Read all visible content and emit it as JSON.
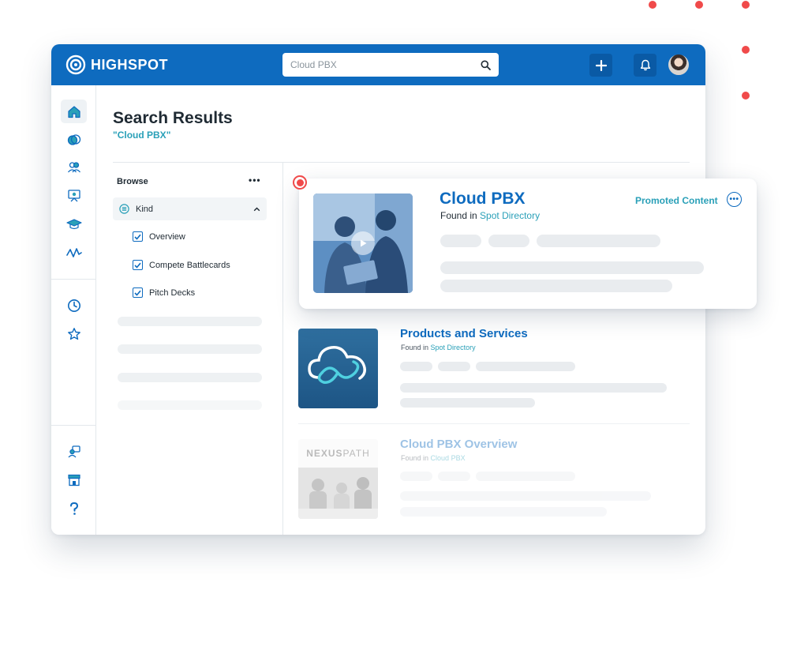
{
  "app": {
    "brand": "HIGHSPOT"
  },
  "search": {
    "placeholder": "Cloud PBX"
  },
  "page": {
    "title": "Search Results",
    "query": "\"Cloud PBX\""
  },
  "browse": {
    "title": "Browse",
    "more": "•••",
    "kind_label": "Kind",
    "filters": [
      {
        "label": "Overview",
        "checked": true
      },
      {
        "label": "Compete Battlecards",
        "checked": true
      },
      {
        "label": "Pitch Decks",
        "checked": true
      }
    ]
  },
  "promoted": {
    "title": "Cloud PBX",
    "found_prefix": "Found in",
    "found_link": "Spot Directory",
    "badge": "Promoted Content",
    "more": "•••"
  },
  "results": [
    {
      "title": "Products and Services",
      "found_prefix": "Found in",
      "found_link": "Spot Directory"
    },
    {
      "title": "Cloud PBX Overview",
      "found_prefix": "Found in",
      "found_link": "Cloud PBX",
      "thumb_text_a": "NEXUS",
      "thumb_text_b": "PATH"
    }
  ],
  "colors": {
    "brand": "#0e6bbf",
    "accent": "#2aa0b8",
    "alert": "#f04a4a"
  }
}
